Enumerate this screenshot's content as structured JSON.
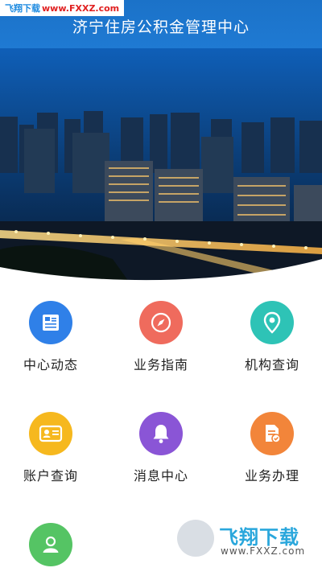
{
  "watermark_top": {
    "part1": "飞翔下载",
    "part2": "www.FXXZ.com"
  },
  "header": {
    "title": "济宁住房公积金管理中心"
  },
  "menu": [
    {
      "label": "中心动态",
      "icon": "news-icon",
      "color": "#2f80e8"
    },
    {
      "label": "业务指南",
      "icon": "compass-icon",
      "color": "#ef6b5d"
    },
    {
      "label": "机构查询",
      "icon": "location-pin-icon",
      "color": "#2ec3b6"
    },
    {
      "label": "账户查询",
      "icon": "id-card-icon",
      "color": "#f6b81e"
    },
    {
      "label": "消息中心",
      "icon": "bell-icon",
      "color": "#8a55d6"
    },
    {
      "label": "业务办理",
      "icon": "document-edit-icon",
      "color": "#f2853a"
    },
    {
      "label": "",
      "icon": "user-icon",
      "color": "#55c464"
    }
  ],
  "watermark_bottom": {
    "brand": "飞翔下载",
    "url": "www.FXXZ.com"
  }
}
